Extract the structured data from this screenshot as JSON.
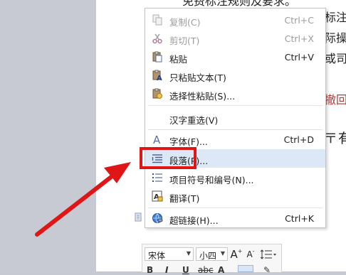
{
  "document": {
    "lines": [
      {
        "text": "免费标注规则及要求。",
        "style": "normal"
      },
      {
        "text": "标注",
        "style": "normal"
      },
      {
        "text": "际操作",
        "style": "normal"
      },
      {
        "text": "或司务",
        "style": "normal"
      },
      {
        "text": "撤回",
        "style": "red"
      },
      {
        "text": "有",
        "style": "big"
      }
    ]
  },
  "context_menu": {
    "items": [
      {
        "label": "复制(C)",
        "shortcut": "Ctrl+C",
        "icon": "copy-icon",
        "disabled": true
      },
      {
        "label": "剪切(T)",
        "shortcut": "Ctrl+X",
        "icon": "cut-icon",
        "disabled": true
      },
      {
        "label": "粘贴",
        "shortcut": "Ctrl+V",
        "icon": "paste-icon",
        "disabled": false
      },
      {
        "label": "只粘贴文本(T)",
        "shortcut": "",
        "icon": "paste-text-icon",
        "disabled": false
      },
      {
        "label": "选择性粘贴(S)...",
        "shortcut": "",
        "icon": "paste-special-icon",
        "disabled": false
      },
      {
        "label": "汉字重选(V)",
        "shortcut": "",
        "icon": "",
        "disabled": false
      },
      {
        "label": "字体(F)...",
        "shortcut": "Ctrl+D",
        "icon": "font-icon",
        "disabled": false
      },
      {
        "label": "段落(P)...",
        "shortcut": "",
        "icon": "paragraph-icon",
        "disabled": false,
        "highlighted": true
      },
      {
        "label": "项目符号和编号(N)...",
        "shortcut": "",
        "icon": "bullets-icon",
        "disabled": false
      },
      {
        "label": "翻译(T)",
        "shortcut": "",
        "icon": "translate-icon",
        "disabled": false
      },
      {
        "label": "超链接(H)...",
        "shortcut": "Ctrl+K",
        "icon": "hyperlink-icon",
        "disabled": false
      }
    ]
  },
  "mini_toolbar": {
    "font_name": "宋体",
    "font_size": "小四",
    "grow_font": "A",
    "shrink_font": "A",
    "row2": [
      "B",
      "I",
      "U",
      "abc",
      "A",
      "",
      ""
    ]
  },
  "colors": {
    "accent_highlight": "#dce8f6",
    "annotation_red": "#e01616",
    "menu_disabled": "#9c9c9c"
  }
}
